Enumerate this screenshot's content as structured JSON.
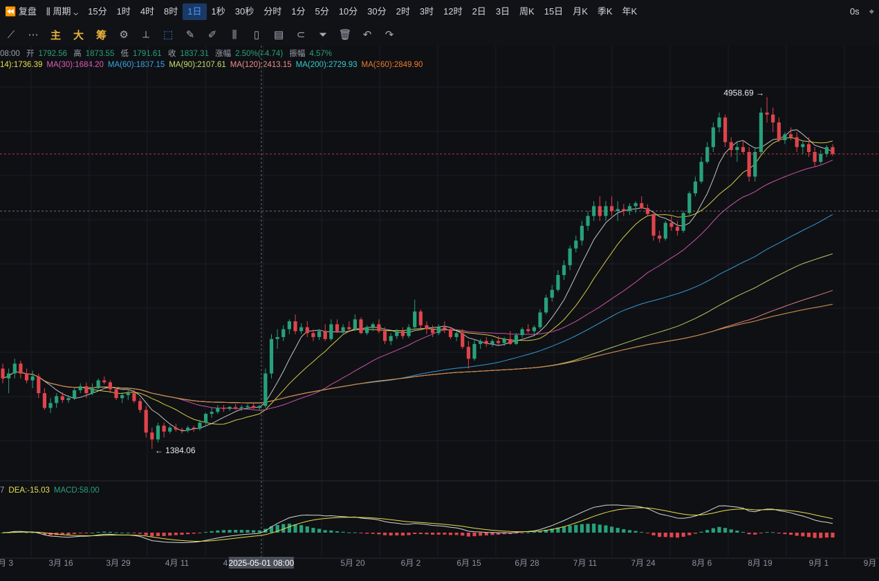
{
  "topbar": {
    "replay": "复盘",
    "period": "周期",
    "intervals": [
      "15分",
      "1时",
      "4时",
      "8时",
      "1日",
      "1秒",
      "30秒",
      "分时",
      "1分",
      "5分",
      "10分",
      "30分",
      "2时",
      "3时",
      "12时",
      "2日",
      "3日",
      "周K",
      "15日",
      "月K",
      "季K",
      "年K"
    ],
    "active_interval": "1日",
    "countdown": "0s"
  },
  "toolbar": {
    "indicators": [
      "主",
      "大",
      "筹"
    ]
  },
  "info": {
    "time": "08:00",
    "open_label": "开",
    "open": "1792.56",
    "high_label": "高",
    "high": "1873.55",
    "low_label": "低",
    "low": "1791.61",
    "close_label": "收",
    "close": "1837.31",
    "change_label": "涨幅",
    "change": "2.50%(44.74)",
    "amplitude_label": "振幅",
    "amplitude": "4.57%"
  },
  "ma_legend": [
    {
      "text": "14):1736.39",
      "color": "#e6e04a"
    },
    {
      "text": "MA(30):1684.20",
      "color": "#e05bb7"
    },
    {
      "text": "MA(60):1837.15",
      "color": "#3aa6e8"
    },
    {
      "text": "MA(90):2107.61",
      "color": "#c6df6a"
    },
    {
      "text": "MA(120):2413.15",
      "color": "#f08a8a"
    },
    {
      "text": "MA(200):2729.93",
      "color": "#2fd0d0"
    },
    {
      "text": "MA(360):2849.90",
      "color": "#f07a2a"
    }
  ],
  "macd_legend": [
    {
      "text": "7",
      "color": "#9aa0ab"
    },
    {
      "text": "DEA:-15.03",
      "color": "#e6e04a"
    },
    {
      "text": "MACD:58.00",
      "color": "#27a17a"
    }
  ],
  "chart_data": {
    "type": "candlestick",
    "x_labels": [
      "月 3",
      "3月 16",
      "3月 29",
      "4月 11",
      "4",
      "5月 20",
      "6月 2",
      "6月 15",
      "6月 28",
      "7月 11",
      "7月 24",
      "8月 6",
      "8月 19",
      "9月 1",
      "9月"
    ],
    "crosshair_date": "2025-05-01 08:00",
    "annotations": [
      {
        "text": "4958.69",
        "type": "high"
      },
      {
        "text": "1384.06",
        "type": "low"
      }
    ],
    "ylim": [
      1200,
      5200
    ],
    "up_color": "#27a17a",
    "down_color": "#e0444c",
    "ohlc": [
      [
        2200,
        2250,
        2050,
        2100
      ],
      [
        2100,
        2200,
        1950,
        2150
      ],
      [
        2150,
        2300,
        2100,
        2250
      ],
      [
        2250,
        2280,
        2100,
        2150
      ],
      [
        2150,
        2200,
        2050,
        2080
      ],
      [
        2080,
        2180,
        2000,
        2120
      ],
      [
        2120,
        2150,
        1900,
        1950
      ],
      [
        1950,
        2000,
        1780,
        1800
      ],
      [
        1800,
        1900,
        1750,
        1850
      ],
      [
        1850,
        1950,
        1800,
        1920
      ],
      [
        1920,
        1960,
        1850,
        1880
      ],
      [
        1880,
        1930,
        1850,
        1900
      ],
      [
        1900,
        2000,
        1880,
        1980
      ],
      [
        1980,
        2050,
        1950,
        2020
      ],
      [
        2020,
        2060,
        1900,
        1950
      ],
      [
        1950,
        2050,
        1930,
        2000
      ],
      [
        2000,
        2100,
        1990,
        2080
      ],
      [
        2080,
        2120,
        2040,
        2060
      ],
      [
        2060,
        2080,
        1950,
        1990
      ],
      [
        1990,
        2010,
        1880,
        1900
      ],
      [
        1900,
        1960,
        1850,
        1930
      ],
      [
        1930,
        1980,
        1880,
        1950
      ],
      [
        1950,
        1980,
        1850,
        1870
      ],
      [
        1870,
        1900,
        1750,
        1780
      ],
      [
        1780,
        1820,
        1500,
        1550
      ],
      [
        1550,
        1600,
        1384,
        1480
      ],
      [
        1480,
        1650,
        1450,
        1620
      ],
      [
        1620,
        1650,
        1500,
        1560
      ],
      [
        1560,
        1620,
        1540,
        1600
      ],
      [
        1600,
        1640,
        1560,
        1580
      ],
      [
        1580,
        1600,
        1540,
        1570
      ],
      [
        1570,
        1620,
        1550,
        1600
      ],
      [
        1600,
        1620,
        1560,
        1590
      ],
      [
        1590,
        1680,
        1570,
        1650
      ],
      [
        1650,
        1750,
        1630,
        1740
      ],
      [
        1740,
        1800,
        1700,
        1760
      ],
      [
        1760,
        1830,
        1740,
        1800
      ],
      [
        1800,
        1830,
        1760,
        1790
      ],
      [
        1790,
        1820,
        1770,
        1810
      ],
      [
        1810,
        1840,
        1780,
        1800
      ],
      [
        1800,
        1830,
        1770,
        1810
      ],
      [
        1810,
        1840,
        1790,
        1820
      ],
      [
        1820,
        1850,
        1790,
        1800
      ],
      [
        1800,
        1830,
        1780,
        1820
      ],
      [
        1820,
        2200,
        1800,
        2150
      ],
      [
        2150,
        2550,
        2100,
        2500
      ],
      [
        2500,
        2600,
        2400,
        2520
      ],
      [
        2520,
        2640,
        2480,
        2600
      ],
      [
        2600,
        2700,
        2550,
        2680
      ],
      [
        2680,
        2750,
        2550,
        2580
      ],
      [
        2580,
        2660,
        2550,
        2620
      ],
      [
        2620,
        2680,
        2520,
        2560
      ],
      [
        2560,
        2600,
        2480,
        2520
      ],
      [
        2520,
        2600,
        2490,
        2580
      ],
      [
        2580,
        2650,
        2480,
        2500
      ],
      [
        2500,
        2700,
        2480,
        2650
      ],
      [
        2650,
        2700,
        2560,
        2580
      ],
      [
        2580,
        2650,
        2540,
        2620
      ],
      [
        2620,
        2680,
        2580,
        2600
      ],
      [
        2600,
        2750,
        2580,
        2700
      ],
      [
        2700,
        2720,
        2550,
        2560
      ],
      [
        2560,
        2640,
        2540,
        2620
      ],
      [
        2620,
        2670,
        2580,
        2650
      ],
      [
        2650,
        2700,
        2560,
        2580
      ],
      [
        2580,
        2620,
        2450,
        2480
      ],
      [
        2480,
        2560,
        2440,
        2530
      ],
      [
        2530,
        2600,
        2500,
        2580
      ],
      [
        2580,
        2620,
        2500,
        2530
      ],
      [
        2530,
        2650,
        2510,
        2620
      ],
      [
        2620,
        2900,
        2600,
        2780
      ],
      [
        2780,
        2800,
        2600,
        2640
      ],
      [
        2640,
        2680,
        2550,
        2600
      ],
      [
        2600,
        2640,
        2520,
        2560
      ],
      [
        2560,
        2650,
        2540,
        2620
      ],
      [
        2620,
        2680,
        2560,
        2600
      ],
      [
        2600,
        2620,
        2500,
        2520
      ],
      [
        2520,
        2580,
        2480,
        2560
      ],
      [
        2560,
        2600,
        2400,
        2420
      ],
      [
        2420,
        2480,
        2200,
        2300
      ],
      [
        2300,
        2500,
        2280,
        2450
      ],
      [
        2450,
        2500,
        2400,
        2480
      ],
      [
        2480,
        2520,
        2420,
        2450
      ],
      [
        2450,
        2500,
        2420,
        2480
      ],
      [
        2480,
        2530,
        2440,
        2460
      ],
      [
        2460,
        2520,
        2430,
        2500
      ],
      [
        2500,
        2580,
        2440,
        2450
      ],
      [
        2450,
        2560,
        2440,
        2540
      ],
      [
        2540,
        2620,
        2510,
        2600
      ],
      [
        2600,
        2650,
        2560,
        2580
      ],
      [
        2580,
        2640,
        2540,
        2620
      ],
      [
        2620,
        2800,
        2600,
        2770
      ],
      [
        2770,
        2950,
        2750,
        2920
      ],
      [
        2920,
        3050,
        2880,
        3000
      ],
      [
        3000,
        3200,
        2980,
        3150
      ],
      [
        3150,
        3300,
        3100,
        3250
      ],
      [
        3250,
        3450,
        3200,
        3420
      ],
      [
        3420,
        3550,
        3380,
        3500
      ],
      [
        3500,
        3700,
        3450,
        3650
      ],
      [
        3650,
        3800,
        3600,
        3750
      ],
      [
        3750,
        3900,
        3700,
        3850
      ],
      [
        3850,
        3950,
        3700,
        3750
      ],
      [
        3750,
        3900,
        3700,
        3850
      ],
      [
        3850,
        3950,
        3750,
        3800
      ],
      [
        3800,
        3900,
        3700,
        3820
      ],
      [
        3820,
        3870,
        3750,
        3800
      ],
      [
        3800,
        3880,
        3760,
        3850
      ],
      [
        3850,
        3900,
        3780,
        3880
      ],
      [
        3880,
        3950,
        3820,
        3830
      ],
      [
        3830,
        3870,
        3750,
        3770
      ],
      [
        3770,
        3800,
        3500,
        3550
      ],
      [
        3550,
        3600,
        3480,
        3520
      ],
      [
        3520,
        3700,
        3500,
        3680
      ],
      [
        3680,
        3750,
        3600,
        3640
      ],
      [
        3640,
        3700,
        3550,
        3600
      ],
      [
        3600,
        3800,
        3580,
        3780
      ],
      [
        3780,
        4000,
        3760,
        3980
      ],
      [
        3980,
        4150,
        3950,
        4100
      ],
      [
        4100,
        4350,
        4080,
        4300
      ],
      [
        4300,
        4500,
        4280,
        4450
      ],
      [
        4450,
        4700,
        4400,
        4650
      ],
      [
        4650,
        4800,
        4600,
        4750
      ],
      [
        4750,
        4780,
        4450,
        4500
      ],
      [
        4500,
        4550,
        4350,
        4420
      ],
      [
        4420,
        4500,
        4300,
        4450
      ],
      [
        4450,
        4520,
        4380,
        4400
      ],
      [
        4400,
        4450,
        4100,
        4150
      ],
      [
        4150,
        4450,
        4100,
        4400
      ],
      [
        4400,
        4850,
        4380,
        4800
      ],
      [
        4800,
        4958,
        4700,
        4780
      ],
      [
        4780,
        4850,
        4600,
        4700
      ],
      [
        4700,
        4750,
        4500,
        4520
      ],
      [
        4520,
        4600,
        4480,
        4580
      ],
      [
        4580,
        4650,
        4520,
        4550
      ],
      [
        4550,
        4600,
        4400,
        4450
      ],
      [
        4450,
        4520,
        4380,
        4480
      ],
      [
        4480,
        4550,
        4350,
        4400
      ],
      [
        4400,
        4450,
        4250,
        4300
      ],
      [
        4300,
        4420,
        4280,
        4380
      ],
      [
        4380,
        4470,
        4350,
        4450
      ],
      [
        4450,
        4480,
        4360,
        4380
      ]
    ]
  }
}
